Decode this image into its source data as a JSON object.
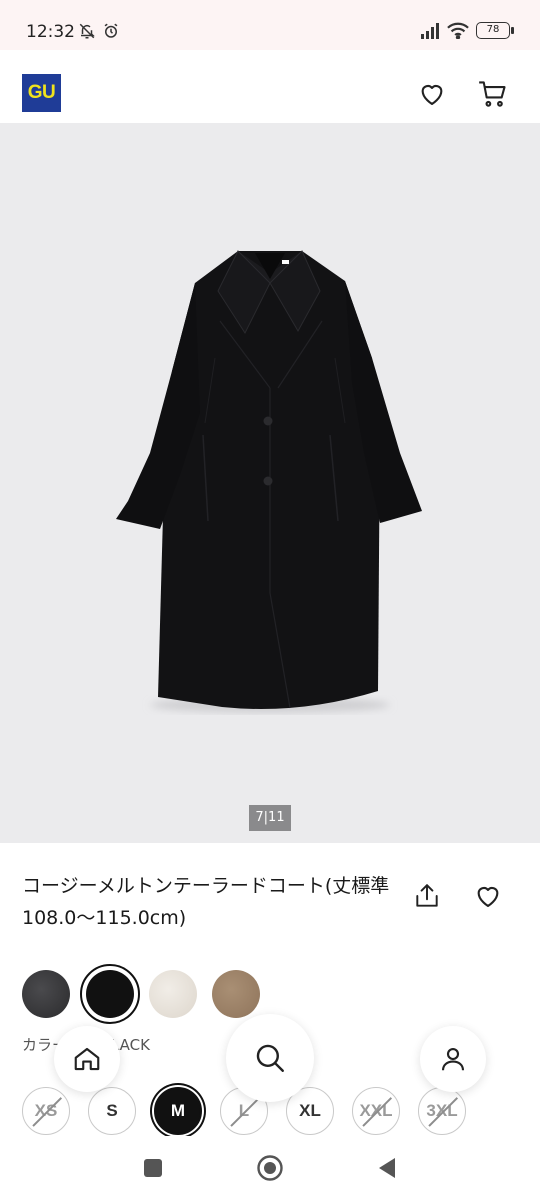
{
  "status_bar": {
    "time": "12:32",
    "battery": "78",
    "icons": [
      "bell-off-icon",
      "alarm-icon",
      "signal-icon",
      "wifi-icon",
      "battery-icon"
    ]
  },
  "header": {
    "logo_text": "GU",
    "icons": [
      "heart-icon",
      "cart-icon"
    ]
  },
  "product": {
    "image_counter": "7|11",
    "title": "コージーメルトンテーラードコート(丈標準108.0〜115.0cm)",
    "color_label": "カラー: 09 BLACK",
    "swatches": [
      {
        "name": "dark-gray",
        "color": "#3a3a3c"
      },
      {
        "name": "black",
        "color": "#111111",
        "selected": true
      },
      {
        "name": "off-white",
        "color": "#e8e3dc"
      },
      {
        "name": "brown",
        "color": "#a08468"
      }
    ],
    "sizes": [
      {
        "label": "XS",
        "available": false
      },
      {
        "label": "S",
        "available": true
      },
      {
        "label": "M",
        "available": true,
        "selected": true
      },
      {
        "label": "L",
        "available": false
      },
      {
        "label": "XL",
        "available": true
      },
      {
        "label": "XXL",
        "available": false
      },
      {
        "label": "3XL",
        "available": false
      }
    ]
  },
  "bottom_nav": {
    "items": [
      "home-icon",
      "search-icon",
      "account-icon"
    ]
  },
  "system_nav": [
    "recents-button",
    "home-button",
    "back-button"
  ],
  "colors": {
    "brand_blue": "#1f3c97",
    "brand_yellow": "#f0e31c",
    "image_bg": "#ebebed",
    "status_bg": "#fdf4f4"
  }
}
